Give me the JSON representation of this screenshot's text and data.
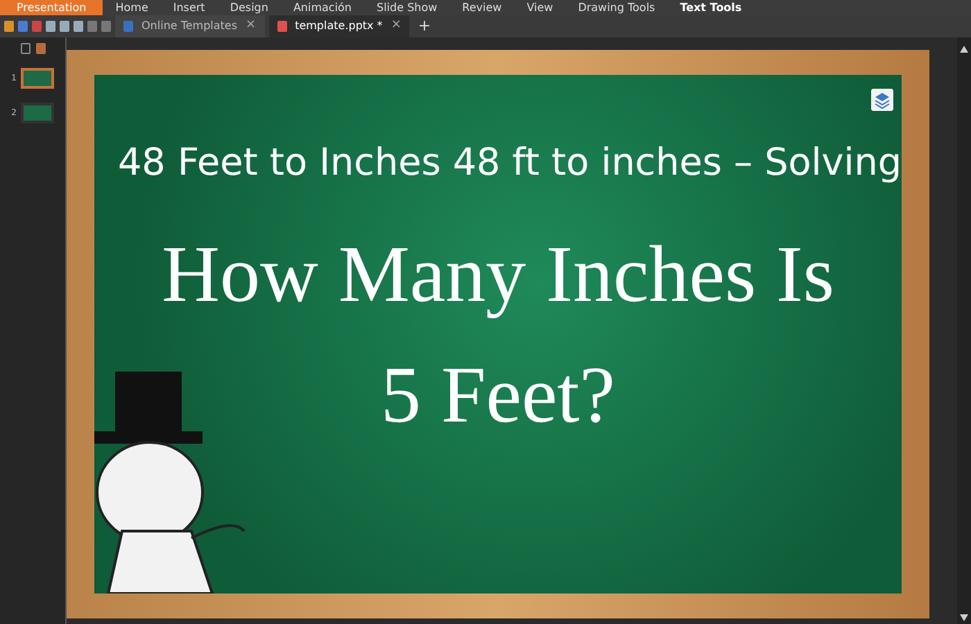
{
  "menu": [
    {
      "label": "Presentation",
      "selected": true
    },
    {
      "label": "Home",
      "selected": false
    },
    {
      "label": "Insert",
      "selected": false
    },
    {
      "label": "Design",
      "selected": false
    },
    {
      "label": "Animación",
      "selected": false
    },
    {
      "label": "Slide Show",
      "selected": false
    },
    {
      "label": "Review",
      "selected": false
    },
    {
      "label": "View",
      "selected": false
    },
    {
      "label": "Drawing Tools",
      "selected": false
    },
    {
      "label": "Text Tools",
      "selected": true
    }
  ],
  "doc_tabs": [
    {
      "label": "Online Templates",
      "selected": false,
      "close": "×"
    },
    {
      "label": "template.pptx *",
      "selected": true,
      "close": "×"
    }
  ],
  "new_tab": "+",
  "slides": [
    {
      "number": "1",
      "selected": true
    },
    {
      "number": "2",
      "selected": false
    }
  ],
  "caption": "48 Feet to Inches 48 ft to inches – Solving",
  "slide": {
    "title_lines": [
      "How Many Inches Is",
      "5 Feet?"
    ]
  }
}
